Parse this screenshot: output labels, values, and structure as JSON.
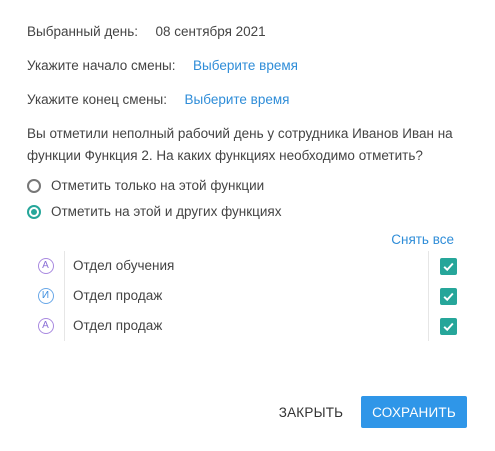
{
  "selected_day": {
    "label": "Выбранный день:",
    "value": "08 сентября 2021"
  },
  "shift_start": {
    "label": "Укажите начало смены:",
    "link": "Выберите время"
  },
  "shift_end": {
    "label": "Укажите конец смены:",
    "link": "Выберите время"
  },
  "question": "Вы отметили неполный рабочий день у сотрудника Иванов Иван на функции Функция 2. На каких функциях необходимо отметить?",
  "options": [
    {
      "label": "Отметить только на этой функции",
      "checked": false
    },
    {
      "label": "Отметить на этой и других функциях",
      "checked": true
    }
  ],
  "clear_all": "Снять все",
  "functions": [
    {
      "badge": "А",
      "badge_color": "#8a6fd6",
      "name": "Отдел обучения",
      "checked": true
    },
    {
      "badge": "И",
      "badge_color": "#3f8fdf",
      "name": "Отдел продаж",
      "checked": true
    },
    {
      "badge": "А",
      "badge_color": "#8a6fd6",
      "name": "Отдел продаж",
      "checked": true
    }
  ],
  "buttons": {
    "close": "ЗАКРЫТЬ",
    "save": "СОХРАНИТЬ"
  },
  "colors": {
    "accent_teal": "#26a69a",
    "link_blue": "#2f8dd8",
    "primary_button": "#2f96e8"
  }
}
